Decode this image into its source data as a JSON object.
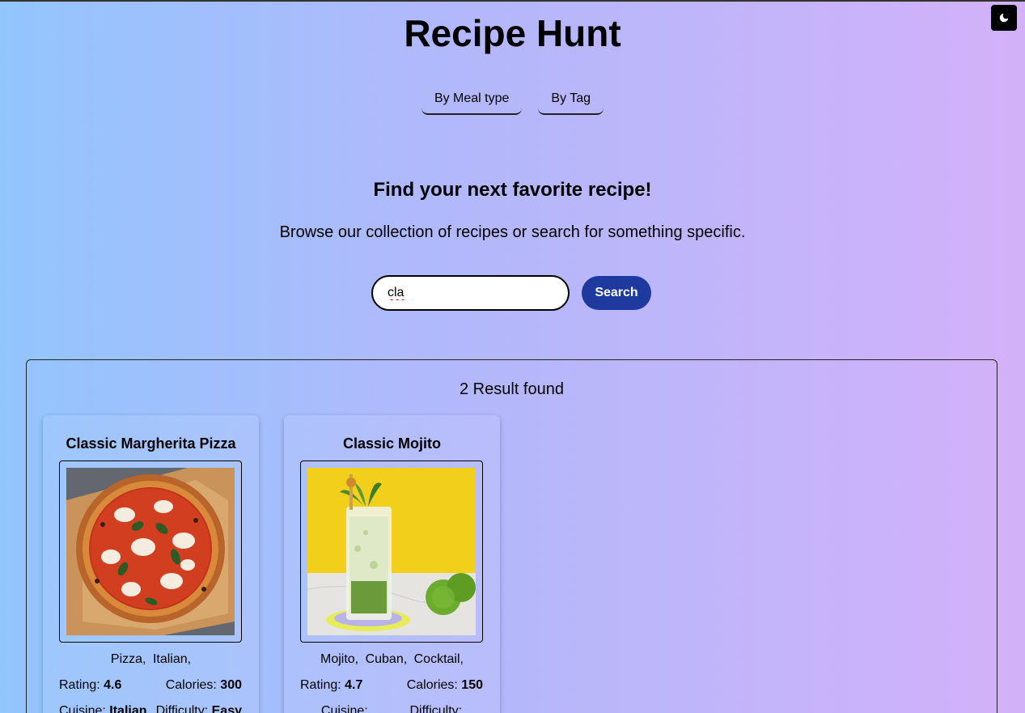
{
  "app": {
    "title": "Recipe Hunt"
  },
  "theme_toggle": {
    "icon": "moon-icon"
  },
  "nav": [
    {
      "label": "By Meal type"
    },
    {
      "label": "By Tag"
    }
  ],
  "hero": {
    "heading": "Find your next favorite recipe!",
    "subheading": "Browse our collection of recipes or search for something specific."
  },
  "search": {
    "value": "cla",
    "button_label": "Search"
  },
  "results": {
    "count_text": "2 Result found",
    "cards": [
      {
        "title": "Classic Margherita Pizza",
        "tags": [
          "Pizza,",
          "Italian,"
        ],
        "rating_label": "Rating:",
        "rating": "4.6",
        "calories_label": "Calories:",
        "calories": "300",
        "cuisine_label": "Cuisine:",
        "cuisine": "Italian",
        "difficulty_label": "Difficulty:",
        "difficulty": "Easy"
      },
      {
        "title": "Classic Mojito",
        "tags": [
          "Mojito,",
          "Cuban,",
          "Cocktail,"
        ],
        "rating_label": "Rating:",
        "rating": "4.7",
        "calories_label": "Calories:",
        "calories": "150",
        "cuisine_label": "Cuisine:",
        "difficulty_label": "Difficulty:"
      }
    ]
  }
}
